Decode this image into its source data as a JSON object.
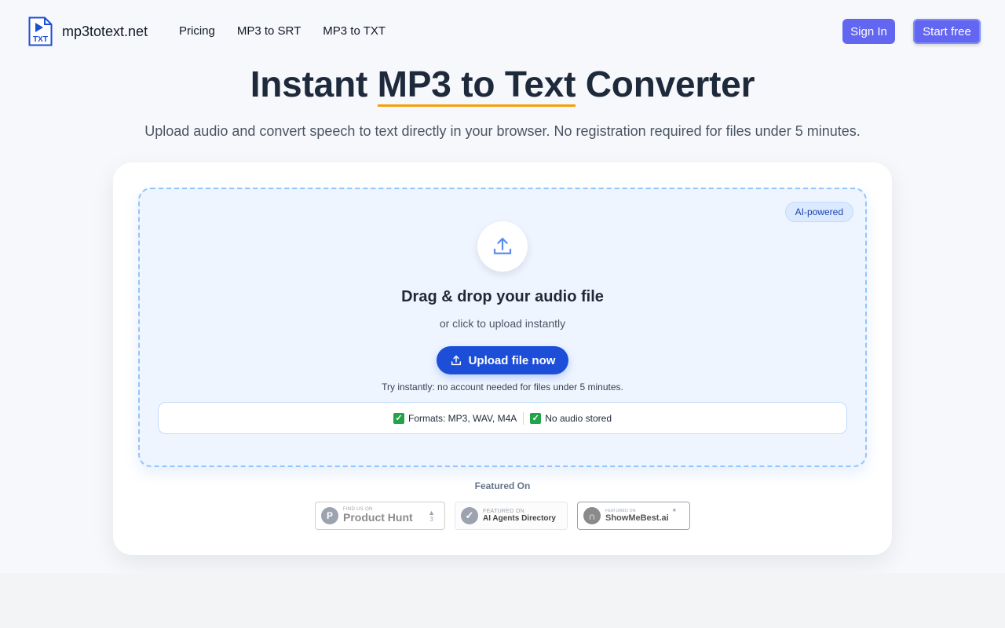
{
  "header": {
    "logo_text": "mp3totext.net",
    "logo_icon_label": "TXT",
    "nav": [
      "Pricing",
      "MP3 to SRT",
      "MP3 to TXT"
    ],
    "signin_label": "Sign In",
    "start_label": "Start free"
  },
  "hero": {
    "title_prefix": "Instant ",
    "title_highlight": "MP3 to Text",
    "title_suffix": " Converter",
    "subtitle": "Upload audio and convert speech to text directly in your browser. No registration required for files under 5 minutes."
  },
  "uploader": {
    "badge": "AI-powered",
    "title": "Drag & drop your audio file",
    "subtitle": "or click to upload instantly",
    "button_label": "Upload file now",
    "note": "Try instantly: no account needed for files under 5 minutes.",
    "features": [
      "Formats: MP3, WAV, M4A",
      "No audio stored"
    ]
  },
  "featured": {
    "label": "Featured On",
    "badges": [
      {
        "small": "FIND US ON",
        "big": "Product Hunt",
        "icon": "P",
        "count": "3"
      },
      {
        "small": "FEATURED ON",
        "big": "AI Agents Directory",
        "icon": "check"
      },
      {
        "small": "FEATURED ON",
        "big": "ShowMeBest.ai",
        "icon": "n"
      }
    ]
  },
  "colors": {
    "accent": "#6366f1",
    "primary_button": "#1d4ed8",
    "highlight_underline": "#f59e0b"
  }
}
